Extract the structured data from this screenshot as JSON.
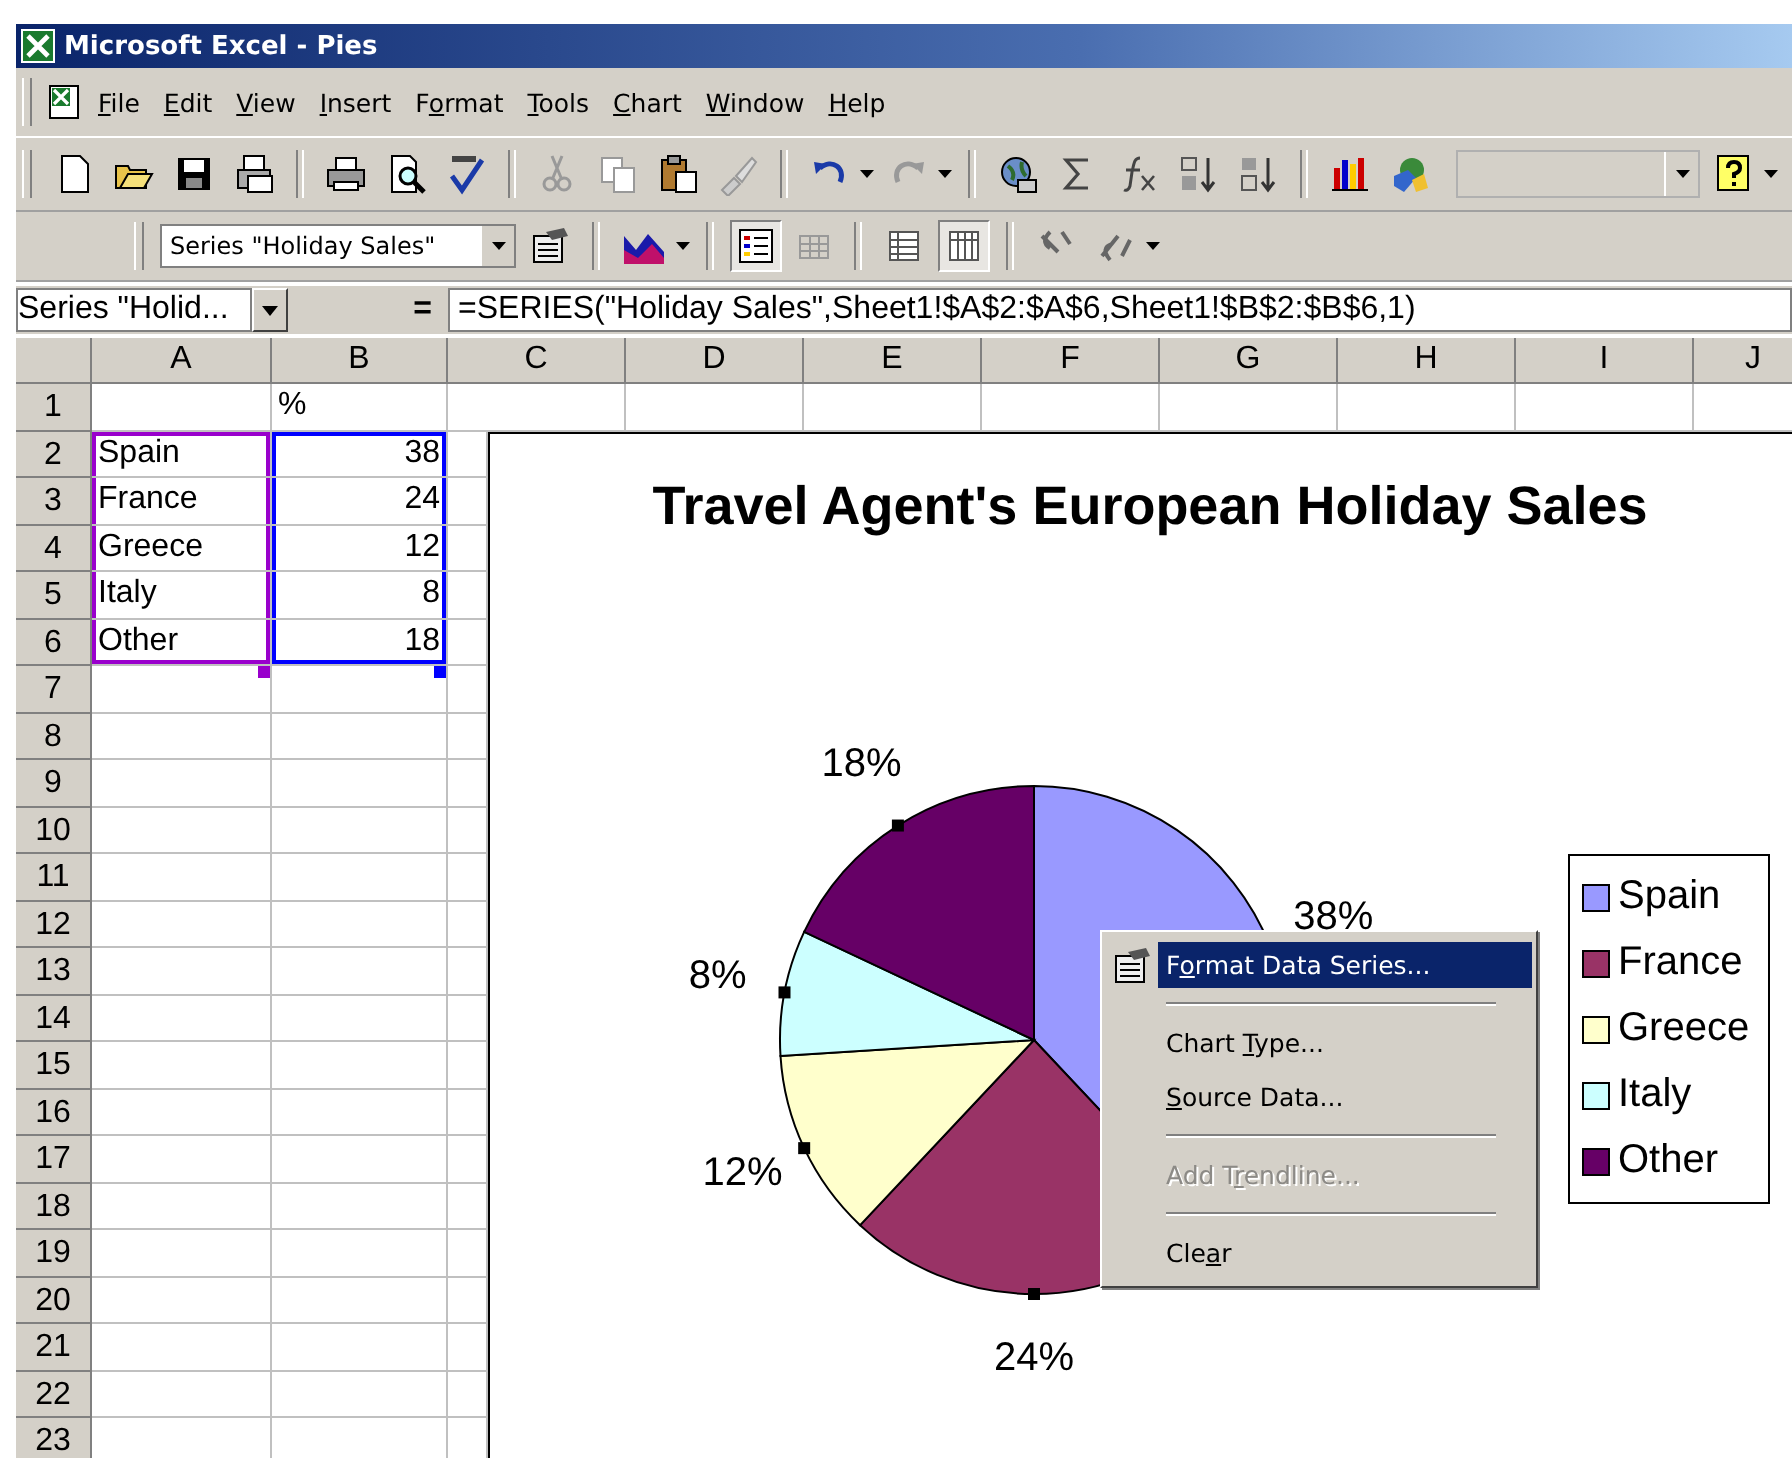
{
  "window": {
    "title": "Microsoft Excel - Pies"
  },
  "menu": [
    {
      "key": "F",
      "post": "ile"
    },
    {
      "key": "E",
      "post": "dit"
    },
    {
      "key": "V",
      "post": "iew"
    },
    {
      "key": "I",
      "post": "nsert"
    },
    {
      "pre": "F",
      "key": "o",
      "post": "rmat"
    },
    {
      "key": "T",
      "post": "ools"
    },
    {
      "key": "C",
      "post": "hart"
    },
    {
      "key": "W",
      "post": "indow"
    },
    {
      "key": "H",
      "post": "elp"
    }
  ],
  "chart_toolbar": {
    "chart_object": "Series \"Holiday Sales\"",
    "legend_on": true,
    "by_row_on": false,
    "by_column_on": true
  },
  "formula_bar": {
    "name_box": "Series \"Holid...",
    "equals": "=",
    "formula": "=SERIES(\"Holiday Sales\",Sheet1!$A$2:$A$6,Sheet1!$B$2:$B$6,1)"
  },
  "sheet": {
    "columns": [
      "A",
      "B",
      "C",
      "D",
      "E",
      "F",
      "G",
      "H",
      "I",
      "J"
    ],
    "rows": [
      {
        "header": "1",
        "b": "%"
      },
      {
        "header": "2",
        "a": "Spain",
        "b": "38"
      },
      {
        "header": "3",
        "a": "France",
        "b": "24"
      },
      {
        "header": "4",
        "a": "Greece",
        "b": "12"
      },
      {
        "header": "5",
        "a": "Italy",
        "b": "8"
      },
      {
        "header": "6",
        "a": "Other",
        "b": "18"
      },
      {
        "header": "7"
      },
      {
        "header": "8"
      },
      {
        "header": "9"
      },
      {
        "header": "10"
      },
      {
        "header": "11"
      },
      {
        "header": "12"
      },
      {
        "header": "13"
      },
      {
        "header": "14"
      },
      {
        "header": "15"
      },
      {
        "header": "16"
      },
      {
        "header": "17"
      },
      {
        "header": "18"
      },
      {
        "header": "19"
      },
      {
        "header": "20"
      },
      {
        "header": "21"
      },
      {
        "header": "22"
      },
      {
        "header": "23"
      }
    ]
  },
  "chart": {
    "chart_data": {
      "type": "pie",
      "title": "Travel Agent's European Holiday Sales",
      "categories": [
        "Spain",
        "France",
        "Greece",
        "Italy",
        "Other"
      ],
      "values": [
        38,
        24,
        12,
        8,
        18
      ],
      "colors": [
        "#9999ff",
        "#993366",
        "#ffffcc",
        "#ccffff",
        "#660066"
      ],
      "value_labels": [
        "38%",
        "24%",
        "12%",
        "8%",
        "18%"
      ],
      "legend": "right"
    }
  },
  "context_menu": {
    "items": [
      {
        "kind": "icon_item",
        "pre": "F",
        "key": "o",
        "post": "rmat Data Series...",
        "selected": true,
        "disabled": false
      },
      {
        "kind": "separator"
      },
      {
        "kind": "item",
        "pre": "Chart ",
        "key": "T",
        "post": "ype...",
        "selected": false,
        "disabled": false
      },
      {
        "kind": "item",
        "key": "S",
        "post": "ource Data...",
        "selected": false,
        "disabled": false
      },
      {
        "kind": "separator"
      },
      {
        "kind": "item",
        "pre": "Add T",
        "key": "r",
        "post": "endline...",
        "selected": false,
        "disabled": true
      },
      {
        "kind": "separator"
      },
      {
        "kind": "item",
        "pre": "Cle",
        "key": "a",
        "post": "r",
        "selected": false,
        "disabled": false
      }
    ]
  }
}
